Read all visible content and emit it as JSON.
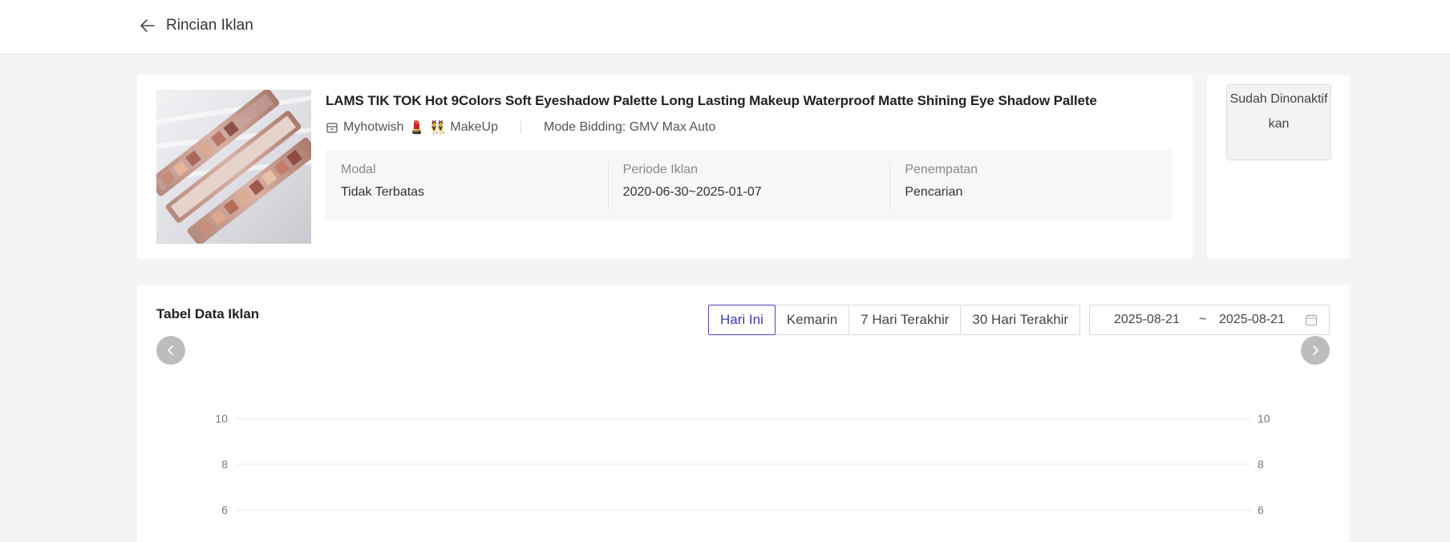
{
  "header": {
    "title": "Rincian Iklan",
    "back_icon": "arrow-left-icon"
  },
  "product": {
    "title": "LAMS TIK TOK Hot 9Colors Soft Eyeshadow Palette Long Lasting Makeup Waterproof Matte Shining Eye Shadow Pallete",
    "store_name": "Myhotwish",
    "store_emoji_1": "💄",
    "store_emoji_2": "👯",
    "store_category": "MakeUp",
    "bidding_mode": "Mode Bidding: GMV Max Auto",
    "info": [
      {
        "label": "Modal",
        "value": "Tidak Terbatas"
      },
      {
        "label": "Periode Iklan",
        "value": "2020-06-30~2025-01-07"
      },
      {
        "label": "Penempatan",
        "value": "Pencarian"
      }
    ]
  },
  "status": {
    "label": "Sudah Dinonaktifkan"
  },
  "data_table": {
    "title": "Tabel Data Iklan",
    "ranges": [
      {
        "label": "Hari Ini",
        "active": true
      },
      {
        "label": "Kemarin",
        "active": false
      },
      {
        "label": "7 Hari Terakhir",
        "active": false
      },
      {
        "label": "30 Hari Terakhir",
        "active": false
      }
    ],
    "date_start": "2025-08-21",
    "date_separator": "~",
    "date_end": "2025-08-21"
  },
  "chart_data": {
    "type": "line",
    "series": [],
    "y_ticks_left": [
      "10",
      "8",
      "6"
    ],
    "y_ticks_right": [
      "10",
      "8",
      "6"
    ],
    "ylim_visible": [
      6,
      10
    ],
    "grid": true,
    "grid_color": "#e3e7ee"
  },
  "colors": {
    "accent": "#3b3bb0",
    "nav_button": "#bdbdbd"
  }
}
